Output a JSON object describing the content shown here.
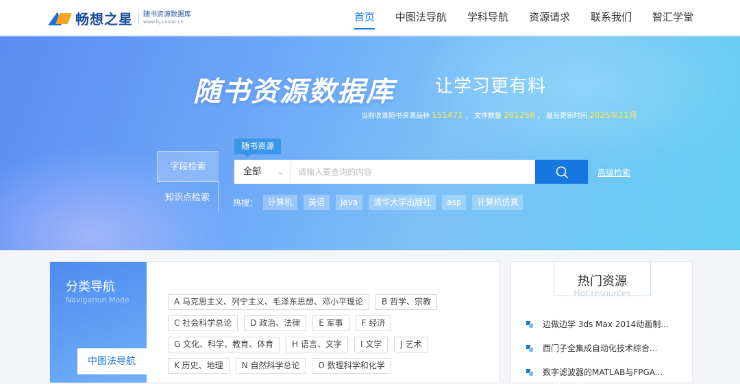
{
  "header": {
    "logo_name": "畅想之星",
    "logo_subtitle": "随书资源数据库",
    "logo_url_text": "www.bj.cxstar.cn",
    "nav": [
      {
        "label": "首页",
        "active": true
      },
      {
        "label": "中图法导航",
        "active": false
      },
      {
        "label": "学科导航",
        "active": false
      },
      {
        "label": "资源请求",
        "active": false
      },
      {
        "label": "联系我们",
        "active": false
      },
      {
        "label": "智汇学堂",
        "active": false
      }
    ]
  },
  "banner": {
    "title": "随书资源数据库",
    "slogan": "让学习更有料",
    "stats": {
      "prefix": "当前收录随书资源品种",
      "resource_count": "151471",
      "mid": "，  文件数量",
      "file_count": "201256",
      "suffix": "，  最后更新时间",
      "updated": "2025年11月"
    },
    "search_tabs": [
      "字段检索",
      "知识点检索"
    ],
    "resource_tag": "随书资源",
    "select_value": "全部",
    "search_placeholder": "请输入要查询的内容",
    "advanced_search": "高级检索",
    "hot_label": "热搜：",
    "hot_tags": [
      "计算机",
      "英语",
      "java",
      "清华大学出版社",
      "asp",
      "计算机仿真"
    ]
  },
  "category": {
    "title": "分类导航",
    "subtitle": "Navigation Mode",
    "tab": "中图法导航",
    "rows": [
      [
        "A 马克思主义、列宁主义、毛泽东思想、邓小平理论",
        "B 哲学、宗教"
      ],
      [
        "C 社会科学总论",
        "D 政治、法律",
        "E 军事",
        "F 经济"
      ],
      [
        "G 文化、科学、教育、体育",
        "H 语言、文字",
        "I 文学",
        "J 艺术"
      ],
      [
        "K 历史、地理",
        "N 自然科学总论",
        "O 数理科学和化学"
      ]
    ]
  },
  "hot_resources": {
    "title": "热门资源",
    "subtitle": "Hot resources",
    "items": [
      "边做边学 3ds Max 2014动画制...",
      "西门子全集成自动化技术综合...",
      "数字滤波器的MATLAB与FPGA..."
    ]
  },
  "colors": {
    "accent": "#1677e0",
    "highlight_number": "#ffe44d",
    "banner_start": "#5a8cf3",
    "banner_end": "#64cef1"
  }
}
